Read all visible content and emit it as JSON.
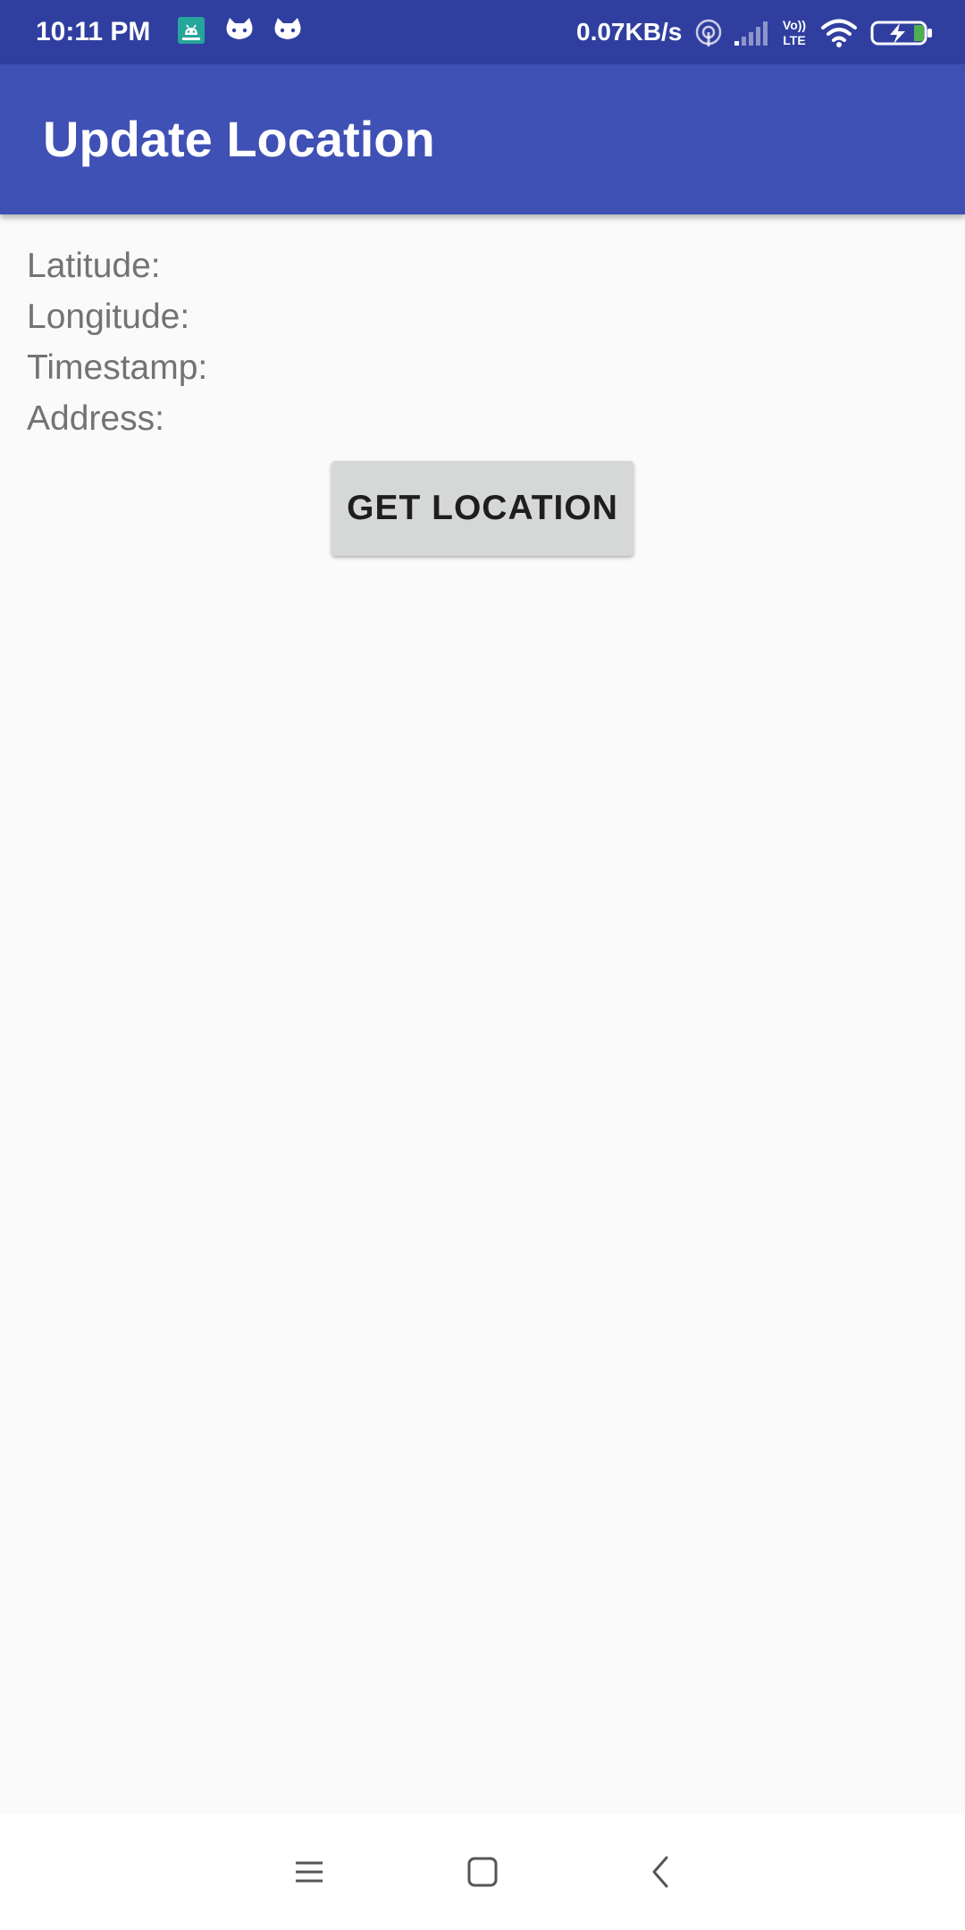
{
  "status_bar": {
    "time": "10:11 PM",
    "network_speed": "0.07KB/s",
    "network_type": "Vo)) LTE",
    "background_color": "#303f9f",
    "notification_icons": [
      "android-debug-icon",
      "cat-notification-icon",
      "cat-notification-icon"
    ],
    "system_icons": [
      "hotspot-icon",
      "signal-icon",
      "volte-icon",
      "wifi-icon",
      "battery-charging-icon"
    ]
  },
  "app_bar": {
    "title": "Update Location",
    "background_color": "#3f51b5"
  },
  "fields": {
    "latitude_label": "Latitude:",
    "longitude_label": "Longitude:",
    "timestamp_label": "Timestamp:",
    "address_label": "Address:"
  },
  "actions": {
    "get_location_label": "GET LOCATION"
  },
  "nav_bar": {
    "icons": [
      "menu-icon",
      "home-icon",
      "back-icon"
    ]
  }
}
